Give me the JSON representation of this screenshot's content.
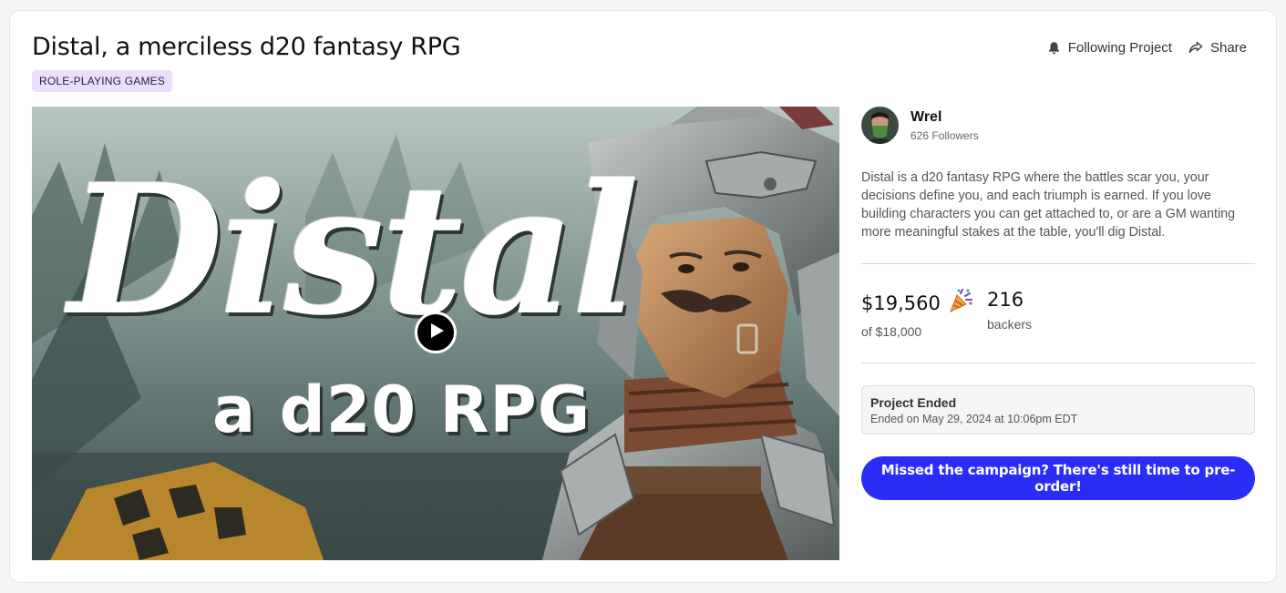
{
  "project": {
    "title": "Distal, a merciless d20 fantasy RPG",
    "category_tag": "ROLE-PLAYING GAMES"
  },
  "actions": {
    "following_label": "Following Project",
    "share_label": "Share"
  },
  "video": {
    "overlay_title": "Distal",
    "overlay_subtitle": "a d20 RPG"
  },
  "creator": {
    "name": "Wrel",
    "followers": "626 Followers"
  },
  "blurb": "Distal is a d20 fantasy RPG where the battles scar you, your decisions define you, and each triumph is earned. If you love building characters you can get attached to, or are a GM wanting more meaningful stakes at the table, you'll dig Distal.",
  "funding": {
    "pledged": "$19,560",
    "goal": "of $18,000",
    "backers_count": "216",
    "backers_label": "backers"
  },
  "status": {
    "title": "Project Ended",
    "date": "Ended on May 29, 2024 at 10:06pm EDT"
  },
  "cta": {
    "label": "Missed the campaign? There's still time to pre-order!"
  },
  "colors": {
    "cta_background": "#2a2df5",
    "tag_background": "#ebe0fb"
  },
  "icons": {
    "following": "bell-icon",
    "share": "share-arrow-icon",
    "funded": "party-popper-icon",
    "play": "play-icon"
  }
}
